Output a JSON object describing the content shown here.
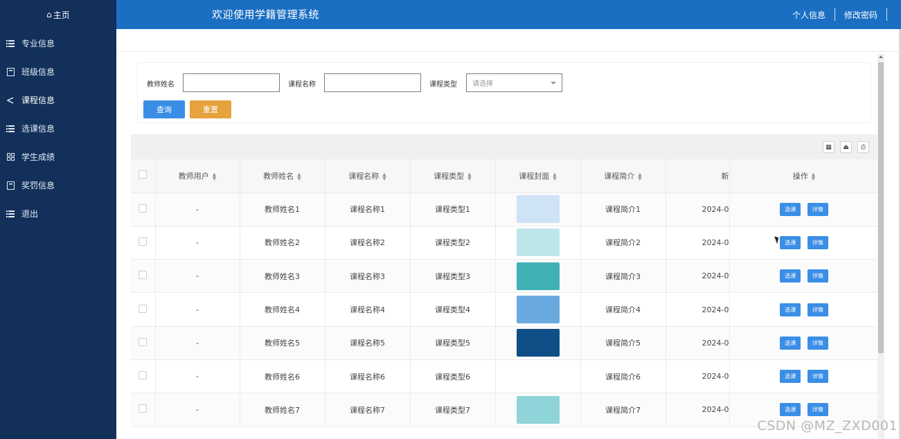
{
  "sidebar": {
    "home": {
      "icon": "home-icon",
      "label": "主页"
    },
    "items": [
      {
        "icon": "list-icon",
        "label": "专业信息"
      },
      {
        "icon": "book-icon",
        "label": "班级信息"
      },
      {
        "icon": "share-icon",
        "label": "课程信息"
      },
      {
        "icon": "list-icon",
        "label": "选课信息"
      },
      {
        "icon": "grid-icon",
        "label": "学生成绩"
      },
      {
        "icon": "book-icon",
        "label": "奖罚信息"
      },
      {
        "icon": "list-icon",
        "label": "退出"
      }
    ]
  },
  "header": {
    "title": "欢迎使用学籍管理系统",
    "profile_link": "个人信息",
    "password_link": "修改密码"
  },
  "search": {
    "teacher_label": "教师姓名",
    "teacher_value": "",
    "course_label": "课程名称",
    "course_value": "",
    "type_label": "课程类型",
    "type_placeholder": "请选择",
    "query_button": "查询",
    "reset_button": "重置"
  },
  "table": {
    "toolbar_icons": [
      "columns-icon",
      "export-icon",
      "print-icon"
    ],
    "headers": [
      "教师用户",
      "教师姓名",
      "课程名称",
      "课程类型",
      "课程封面",
      "课程简介",
      "新",
      "操作"
    ],
    "action_select": "选课",
    "action_detail": "详情",
    "rows": [
      {
        "user": "-",
        "teacher": "教师姓名1",
        "course": "课程名称1",
        "type": "课程类型1",
        "intro": "课程简介1",
        "date": "2024-0",
        "cover": "#cfe3f7"
      },
      {
        "user": "-",
        "teacher": "教师姓名2",
        "course": "课程名称2",
        "type": "课程类型2",
        "intro": "课程简介2",
        "date": "2024-0",
        "cover": "#bde6ea"
      },
      {
        "user": "-",
        "teacher": "教师姓名3",
        "course": "课程名称3",
        "type": "课程类型3",
        "intro": "课程简介3",
        "date": "2024-0",
        "cover": "#3fb1b7"
      },
      {
        "user": "-",
        "teacher": "教师姓名4",
        "course": "课程名称4",
        "type": "课程类型4",
        "intro": "课程简介4",
        "date": "2024-0",
        "cover": "#6aa9e0"
      },
      {
        "user": "-",
        "teacher": "教师姓名5",
        "course": "课程名称5",
        "type": "课程类型5",
        "intro": "课程简介5",
        "date": "2024-0",
        "cover": "#0d4f86"
      },
      {
        "user": "-",
        "teacher": "教师姓名6",
        "course": "课程名称6",
        "type": "课程类型6",
        "intro": "课程简介6",
        "date": "2024-0",
        "cover": ""
      },
      {
        "user": "-",
        "teacher": "教师姓名7",
        "course": "课程名称7",
        "type": "课程类型7",
        "intro": "课程简介7",
        "date": "2024-0",
        "cover": "#8fd4d8"
      }
    ]
  },
  "watermark": "CSDN @MZ_ZXD001",
  "colors": {
    "sidebar": "#12305a",
    "header": "#1b6fc2",
    "primary": "#3a8ee6",
    "warning": "#e6a23c"
  }
}
